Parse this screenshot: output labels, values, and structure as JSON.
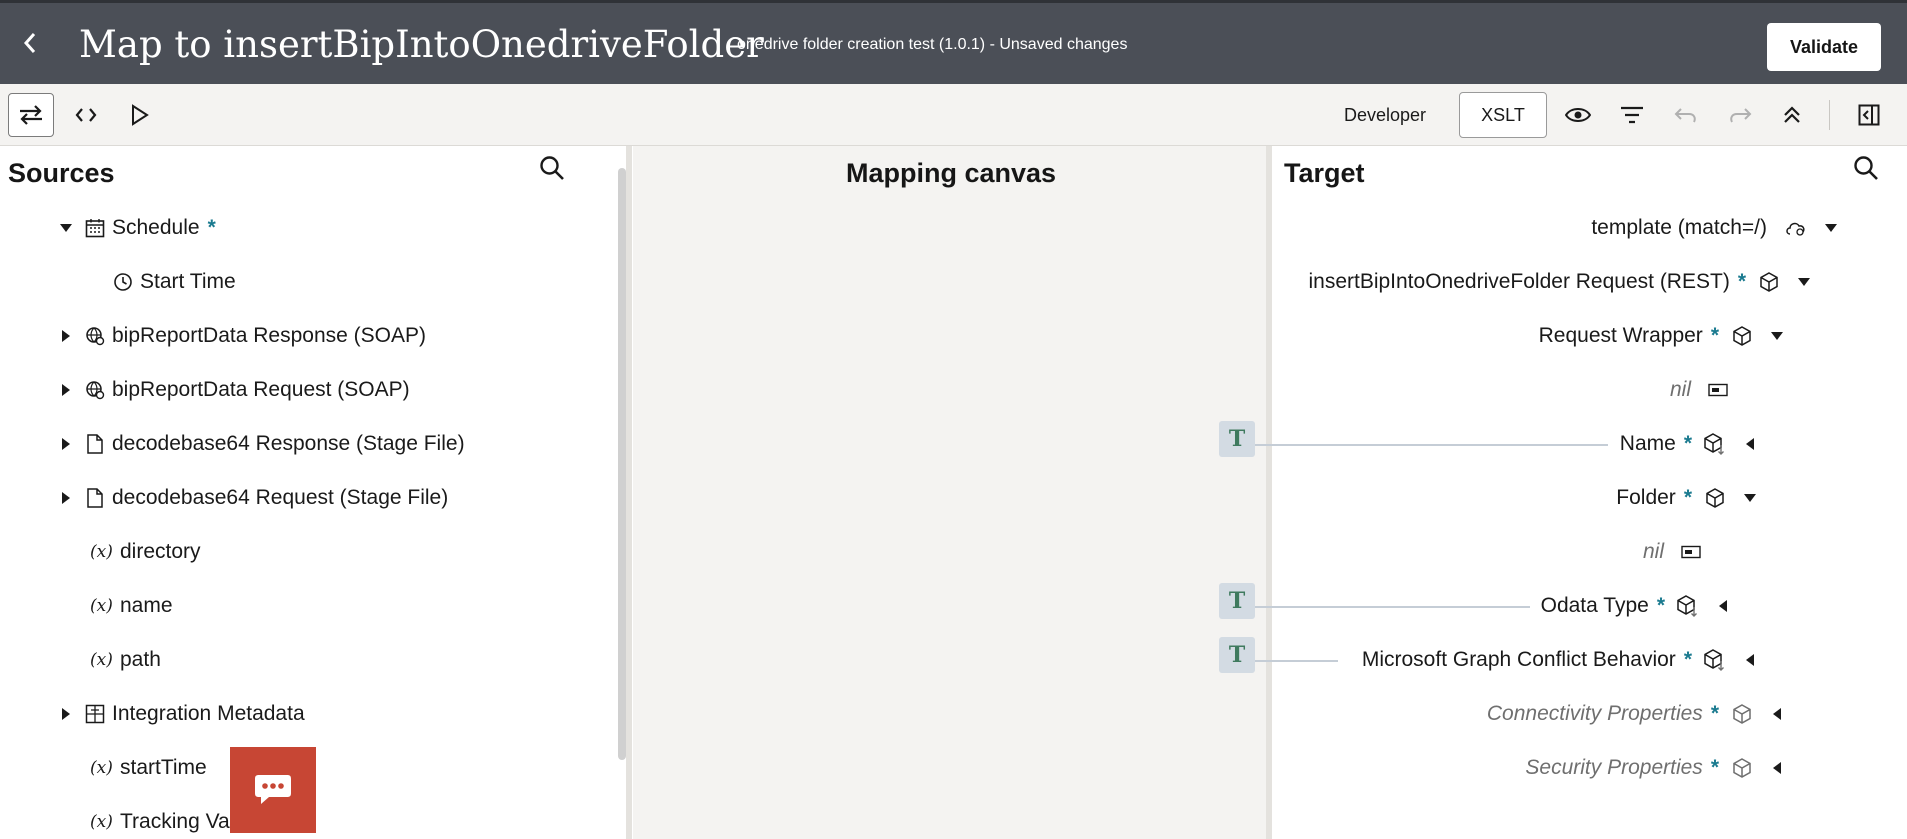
{
  "header": {
    "title": "Map to insertBipIntoOnedriveFolder",
    "subtitle": "onedrive folder creation test (1.0.1) - Unsaved changes",
    "validate_label": "Validate"
  },
  "toolbar": {
    "developer_label": "Developer",
    "xslt_label": "XSLT"
  },
  "sources": {
    "title": "Sources",
    "items": [
      {
        "label": "Schedule",
        "icon": "calendar-icon",
        "required": "*"
      },
      {
        "label": "Start Time",
        "icon": "clock-icon"
      },
      {
        "label": "bipReportData Response (SOAP)",
        "icon": "globe-gear-icon"
      },
      {
        "label": "bipReportData Request (SOAP)",
        "icon": "globe-gear-icon"
      },
      {
        "label": "decodebase64 Response (Stage File)",
        "icon": "file-icon"
      },
      {
        "label": "decodebase64 Request (Stage File)",
        "icon": "file-icon"
      },
      {
        "label": "directory",
        "icon": "variable-icon"
      },
      {
        "label": "name",
        "icon": "variable-icon"
      },
      {
        "label": "path",
        "icon": "variable-icon"
      },
      {
        "label": "Integration Metadata",
        "icon": "grid-icon"
      },
      {
        "label": "startTime",
        "icon": "variable-icon"
      },
      {
        "label": "Tracking Va",
        "icon": "variable-icon"
      }
    ],
    "variable_glyph": "(x)"
  },
  "canvas": {
    "title": "Mapping canvas",
    "t_glyph": "T"
  },
  "target": {
    "title": "Target",
    "items": [
      {
        "label": "template (match=/)"
      },
      {
        "label": "insertBipIntoOnedriveFolder Request (REST)",
        "required": "*"
      },
      {
        "label": "Request Wrapper",
        "required": "*"
      },
      {
        "label": "nil"
      },
      {
        "label": "Name",
        "required": "*"
      },
      {
        "label": "Folder",
        "required": "*"
      },
      {
        "label": "nil"
      },
      {
        "label": "Odata Type",
        "required": "*"
      },
      {
        "label": "Microsoft Graph Conflict Behavior",
        "required": "*"
      },
      {
        "label": "Connectivity Properties",
        "required": "*"
      },
      {
        "label": "Security Properties",
        "required": "*"
      }
    ]
  },
  "colors": {
    "header_bg": "#4b4f57",
    "toolbar_bg": "#f4f3f1",
    "canvas_bg": "#f4f3f1",
    "required_accent": "#1a7a8f",
    "chat_button": "#c74634"
  }
}
